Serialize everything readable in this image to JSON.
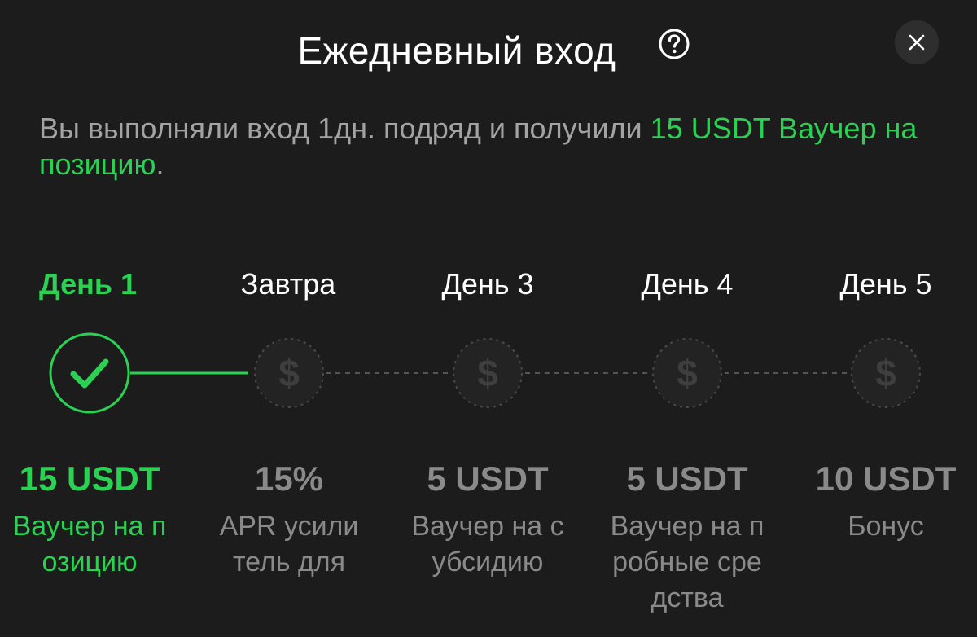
{
  "header": {
    "title": "Ежедневный вход",
    "help_icon": "question-circle-icon",
    "close_icon": "close-icon"
  },
  "message": {
    "prefix": "Вы выполняли вход 1дн. подряд и получили ",
    "highlight": "15 USDT Ваучер на позицию",
    "suffix": "."
  },
  "days": [
    {
      "label": "День 1",
      "amount": "15 USDT",
      "description": "Ваучер на позицию",
      "state": "claimed",
      "icon": "checkmark-icon"
    },
    {
      "label": "Завтра",
      "amount": "15%",
      "description": "APR усилитель для",
      "state": "locked",
      "icon": "dollar-icon"
    },
    {
      "label": "День 3",
      "amount": "5 USDT",
      "description": "Ваучер на субсидию",
      "state": "locked",
      "icon": "dollar-icon"
    },
    {
      "label": "День 4",
      "amount": "5 USDT",
      "description": "Ваучер на пробные средства",
      "state": "locked",
      "icon": "dollar-icon"
    },
    {
      "label": "День 5",
      "amount": "10 USDT",
      "description": "Бонус",
      "state": "locked",
      "icon": "dollar-icon"
    }
  ],
  "colors": {
    "accent": "#2ad152",
    "background": "#1c1c1c",
    "muted": "#8a8a8a",
    "text": "#ffffff"
  }
}
